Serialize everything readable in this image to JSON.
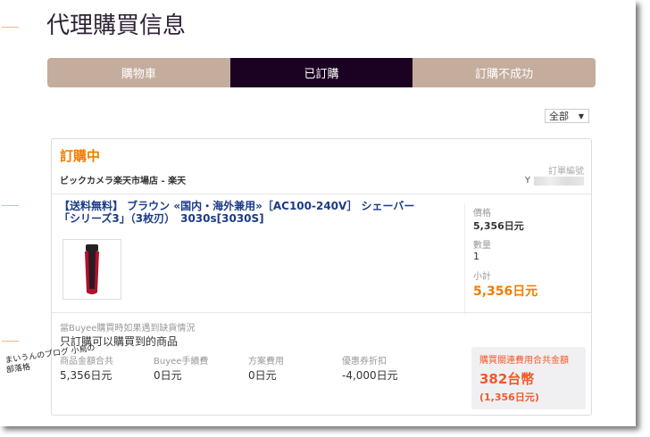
{
  "page_title": "代理購買信息",
  "tabs": [
    {
      "label": "購物車"
    },
    {
      "label": "已訂購"
    },
    {
      "label": "訂購不成功"
    }
  ],
  "filter": {
    "selected": "全部"
  },
  "order": {
    "status": "訂購中",
    "store": "ビックカメラ楽天市場店 - 楽天",
    "order_no_label": "訂單編號",
    "order_no": "Y",
    "product_title": "【送料無料】 ブラウン «国内・海外兼用»［AC100-240V］ シェーバー「シリーズ3」（3枚刃）　3030s[3030S]",
    "price_label": "價格",
    "price": "5,356日元",
    "qty_label": "數量",
    "qty": "1",
    "subtotal_label": "小計",
    "subtotal": "5,356日元",
    "oos_label": "當Buyee購買時如果遇到缺貨情況",
    "oos_value": "只訂購可以購買到的商品",
    "fees": [
      {
        "label": "商品金額合共",
        "value": "5,356日元"
      },
      {
        "label": "Buyee手續費",
        "value": "0日元"
      },
      {
        "label": "方案費用",
        "value": "0日元"
      },
      {
        "label": "優惠券折扣",
        "value": "-4,000日元"
      }
    ],
    "total_label": "購買關連費用合共金額",
    "total_twd": "382台幣",
    "total_jpy": "(1,356日元)"
  },
  "watermark": "まいうんのブログ 小鳥の部落格",
  "colors": {
    "accent": "#f07c00",
    "tab_active": "#1c0222",
    "tab": "#c4ad9c",
    "total": "#f05a28"
  }
}
